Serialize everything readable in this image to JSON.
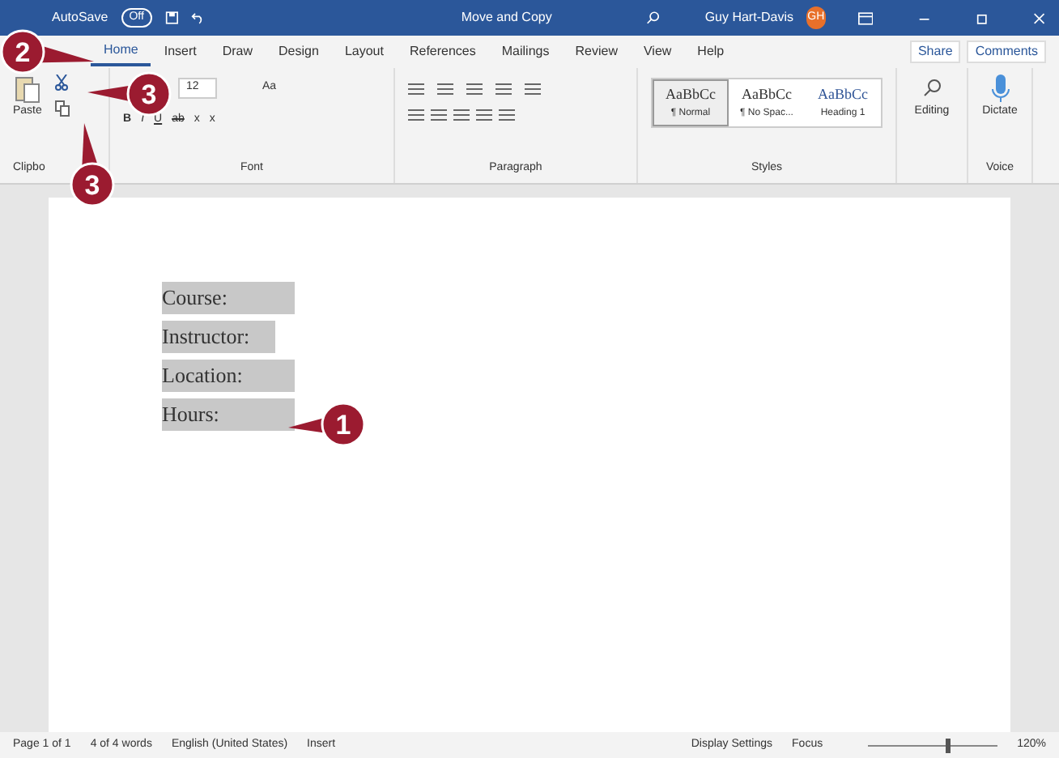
{
  "title_bar": {
    "autosave": "AutoSave",
    "autosave_state": "Off",
    "autosave_on": false,
    "title": "Move and Copy",
    "user": "Guy Hart-Davis",
    "initials": "GH"
  },
  "tabs": [
    {
      "label": "Home",
      "selected": true
    },
    {
      "label": "Insert",
      "selected": false
    },
    {
      "label": "Draw",
      "selected": false
    },
    {
      "label": "Design",
      "selected": false
    },
    {
      "label": "Layout",
      "selected": false
    },
    {
      "label": "References",
      "selected": false
    },
    {
      "label": "Mailings",
      "selected": false
    },
    {
      "label": "Review",
      "selected": false
    },
    {
      "label": "View",
      "selected": false
    },
    {
      "label": "Help",
      "selected": false
    }
  ],
  "share": "Share",
  "comments": "Comments",
  "ribbon": {
    "paste": "Paste",
    "clipboard_label": "Clipbo",
    "font_size": "12",
    "font_case": "Aa",
    "font_buttons": [
      "B",
      "I",
      "U",
      "ab",
      "x",
      "x"
    ],
    "font_label": "Font",
    "paragraph_label": "Paragraph",
    "styles": [
      {
        "preview": "AaBbCc",
        "name": "¶ Normal",
        "selected": true
      },
      {
        "preview": "AaBbCc",
        "name": "¶ No Spac...",
        "selected": false
      },
      {
        "preview": "AaBbCc",
        "name": "Heading 1",
        "selected": false
      }
    ],
    "styles_label": "Styles",
    "editing": "Editing",
    "dictate": "Dictate",
    "voice_label": "Voice"
  },
  "document": {
    "lines": [
      {
        "text": "Course:",
        "selected": true
      },
      {
        "text": "Instructor:",
        "selected": true
      },
      {
        "text": "Location:",
        "selected": true
      },
      {
        "text": "Hours:",
        "selected": true
      }
    ]
  },
  "status_bar": {
    "page": "Page 1 of 1",
    "words": "4 of 4 words",
    "language": "English (United States)",
    "mode": "Insert",
    "display": "Display Settings",
    "focus": "Focus",
    "zoom": "120%",
    "level": 0.6
  },
  "callouts": [
    "2",
    "3",
    "3",
    "1"
  ]
}
